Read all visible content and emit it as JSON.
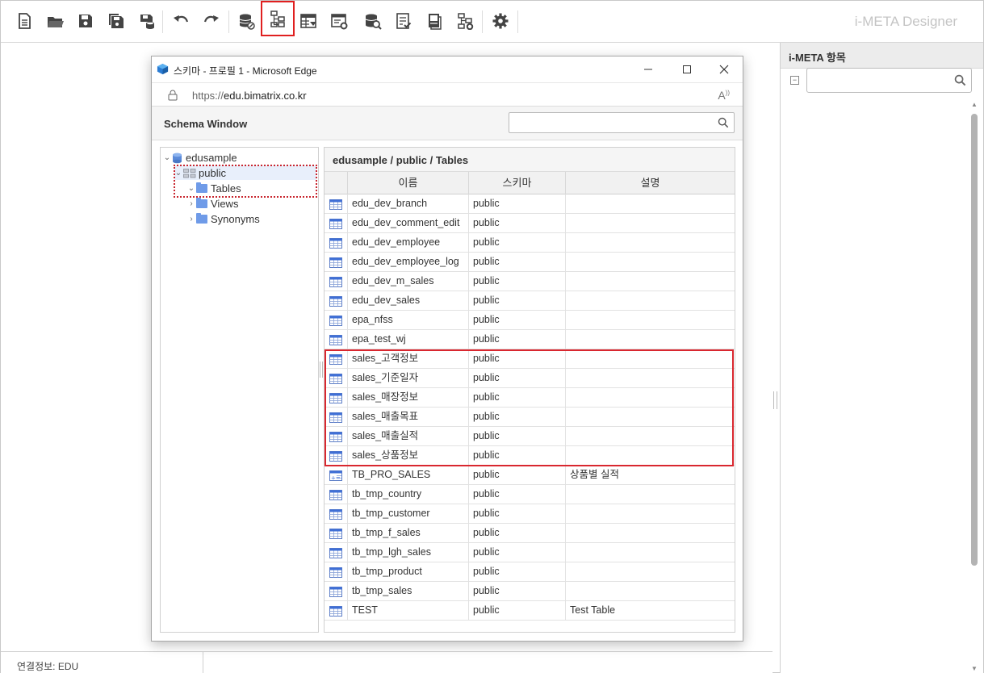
{
  "toolbar": {
    "buttons": [
      {
        "name": "new-document-icon"
      },
      {
        "name": "open-folder-icon"
      },
      {
        "name": "save-icon"
      },
      {
        "name": "save-all-icon"
      },
      {
        "name": "save-db-icon"
      },
      {
        "name": "undo-icon"
      },
      {
        "name": "redo-icon"
      },
      {
        "name": "db-connection-icon"
      },
      {
        "name": "schema-tree-icon"
      },
      {
        "name": "table-settings-icon"
      },
      {
        "name": "window-settings-icon"
      },
      {
        "name": "db-search-icon"
      },
      {
        "name": "checklist-icon"
      },
      {
        "name": "document-icon"
      },
      {
        "name": "hierarchy-settings-icon"
      },
      {
        "name": "gear-icon"
      }
    ],
    "designer_title": "i-META Designer"
  },
  "right_panel": {
    "title": "i-META 항목",
    "search_value": ""
  },
  "status_bar": {
    "connection_label": "연결정보: EDU"
  },
  "edge": {
    "title": "스키마 - 프로필 1 - Microsoft Edge",
    "url_prefix": "https://",
    "url_host": "edu.bimatrix.co.kr",
    "read_aloud": "A̅"
  },
  "schema_window": {
    "title": "Schema Window",
    "search_value": ""
  },
  "tree": {
    "root": "edusample",
    "schema": "public",
    "children": [
      "Tables",
      "Views",
      "Synonyms"
    ]
  },
  "grid": {
    "breadcrumb": "edusample / public / Tables",
    "columns": [
      "이름",
      "스키마",
      "설명"
    ],
    "rows": [
      {
        "name": "edu_dev_branch",
        "schema": "public",
        "desc": "",
        "icon": "table"
      },
      {
        "name": "edu_dev_comment_edit",
        "schema": "public",
        "desc": "",
        "icon": "table"
      },
      {
        "name": "edu_dev_employee",
        "schema": "public",
        "desc": "",
        "icon": "table"
      },
      {
        "name": "edu_dev_employee_log",
        "schema": "public",
        "desc": "",
        "icon": "table"
      },
      {
        "name": "edu_dev_m_sales",
        "schema": "public",
        "desc": "",
        "icon": "table"
      },
      {
        "name": "edu_dev_sales",
        "schema": "public",
        "desc": "",
        "icon": "table"
      },
      {
        "name": "epa_nfss",
        "schema": "public",
        "desc": "",
        "icon": "table"
      },
      {
        "name": "epa_test_wj",
        "schema": "public",
        "desc": "",
        "icon": "table"
      },
      {
        "name": "sales_고객정보",
        "schema": "public",
        "desc": "",
        "icon": "table"
      },
      {
        "name": "sales_기준일자",
        "schema": "public",
        "desc": "",
        "icon": "table"
      },
      {
        "name": "sales_매장정보",
        "schema": "public",
        "desc": "",
        "icon": "table"
      },
      {
        "name": "sales_매출목표",
        "schema": "public",
        "desc": "",
        "icon": "table"
      },
      {
        "name": "sales_매출실적",
        "schema": "public",
        "desc": "",
        "icon": "table"
      },
      {
        "name": "sales_상품정보",
        "schema": "public",
        "desc": "",
        "icon": "table"
      },
      {
        "name": "TB_PRO_SALES",
        "schema": "public",
        "desc": "상품별 실적",
        "icon": "table-calc"
      },
      {
        "name": "tb_tmp_country",
        "schema": "public",
        "desc": "",
        "icon": "table"
      },
      {
        "name": "tb_tmp_customer",
        "schema": "public",
        "desc": "",
        "icon": "table"
      },
      {
        "name": "tb_tmp_f_sales",
        "schema": "public",
        "desc": "",
        "icon": "table"
      },
      {
        "name": "tb_tmp_lgh_sales",
        "schema": "public",
        "desc": "",
        "icon": "table"
      },
      {
        "name": "tb_tmp_product",
        "schema": "public",
        "desc": "",
        "icon": "table"
      },
      {
        "name": "tb_tmp_sales",
        "schema": "public",
        "desc": "",
        "icon": "table"
      },
      {
        "name": "TEST",
        "schema": "public",
        "desc": "Test Table",
        "icon": "table"
      }
    ]
  },
  "colors": {
    "highlight_red": "#d9272f",
    "table_icon_blue": "#3f6fd6",
    "folder_blue": "#6f9be8"
  }
}
